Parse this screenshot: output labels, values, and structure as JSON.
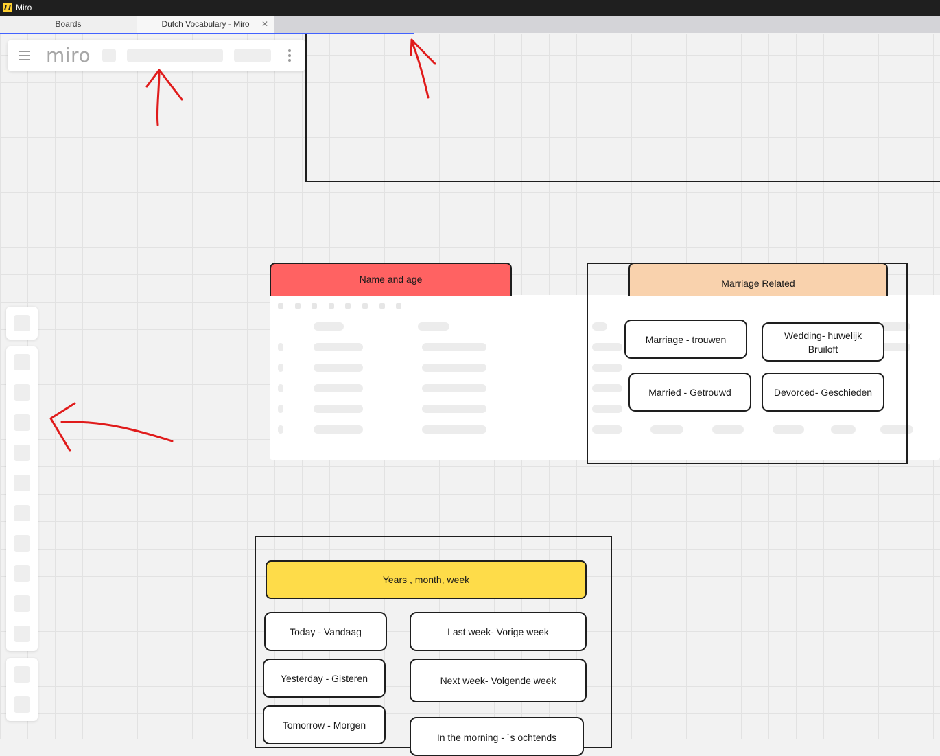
{
  "window": {
    "title": "Miro"
  },
  "tabs": [
    {
      "label": "Boards"
    },
    {
      "label": "Dutch Vocabulary - Miro"
    }
  ],
  "toolbar": {
    "logo": "miro"
  },
  "colors": {
    "red_header": "#ff6262",
    "peach_header": "#f9d2ad",
    "yellow_header": "#fedc49",
    "annotation": "#e01b1b",
    "accent": "#4262ff"
  },
  "icons": {
    "menu": "hamburger-icon",
    "more": "kebab-icon",
    "close": "close-icon"
  },
  "board": {
    "name_age": {
      "title": "Name and age"
    },
    "marriage": {
      "title": "Marriage Related",
      "cards": [
        "Marriage - trouwen",
        "Wedding- huwelijk Bruiloft",
        "Married - Getrouwd",
        "Devorced- Geschieden"
      ]
    },
    "time": {
      "title": "Years , month, week",
      "cards": [
        "Today - Vandaag",
        "Last week- Vorige week",
        "Yesterday - Gisteren",
        "Next week- Volgende week",
        "Tomorrow - Morgen",
        "In the morning - `s ochtends"
      ]
    }
  }
}
